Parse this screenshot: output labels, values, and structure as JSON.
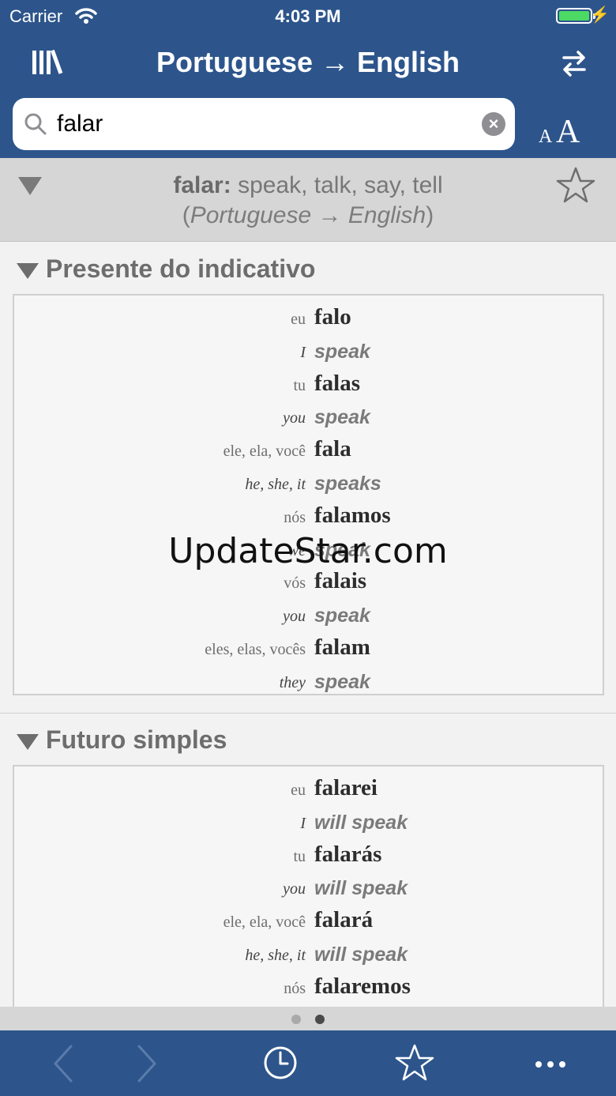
{
  "status_bar": {
    "carrier": "Carrier",
    "time": "4:03 PM"
  },
  "nav": {
    "title": "Portuguese → English"
  },
  "search": {
    "value": "falar",
    "placeholder": ""
  },
  "entry": {
    "word": "falar:",
    "translations": "speak, talk, say, tell",
    "direction": "Portuguese → English"
  },
  "sections": [
    {
      "title": "Presente do indicativo",
      "rows": [
        {
          "pronoun": "eu",
          "verb": "falo",
          "en_pronoun": "I",
          "translation": "speak"
        },
        {
          "pronoun": "tu",
          "verb": "falas",
          "en_pronoun": "you",
          "translation": "speak"
        },
        {
          "pronoun": "ele, ela, você",
          "verb": "fala",
          "en_pronoun": "he, she, it",
          "translation": "speaks"
        },
        {
          "pronoun": "nós",
          "verb": "falamos",
          "en_pronoun": "we",
          "translation": "speak"
        },
        {
          "pronoun": "vós",
          "verb": "falais",
          "en_pronoun": "you",
          "translation": "speak"
        },
        {
          "pronoun": "eles, elas, vocês",
          "verb": "falam",
          "en_pronoun": "they",
          "translation": "speak"
        }
      ]
    },
    {
      "title": "Futuro simples",
      "rows": [
        {
          "pronoun": "eu",
          "verb": "falarei",
          "en_pronoun": "I",
          "translation": "will speak"
        },
        {
          "pronoun": "tu",
          "verb": "falarás",
          "en_pronoun": "you",
          "translation": "will speak"
        },
        {
          "pronoun": "ele, ela, você",
          "verb": "falará",
          "en_pronoun": "he, she, it",
          "translation": "will speak"
        },
        {
          "pronoun": "nós",
          "verb": "falaremos",
          "en_pronoun": "",
          "translation": ""
        }
      ]
    }
  ],
  "watermark": "UpdateStar.com",
  "page_indicator": {
    "count": 2,
    "current": 2
  },
  "toolbar": {
    "icons": [
      "back-arrow-icon",
      "forward-arrow-icon",
      "history-clock-icon",
      "favorites-star-icon",
      "more-ellipsis-icon"
    ]
  },
  "colors": {
    "bar": "#2d558c",
    "battery": "#4cd964"
  }
}
